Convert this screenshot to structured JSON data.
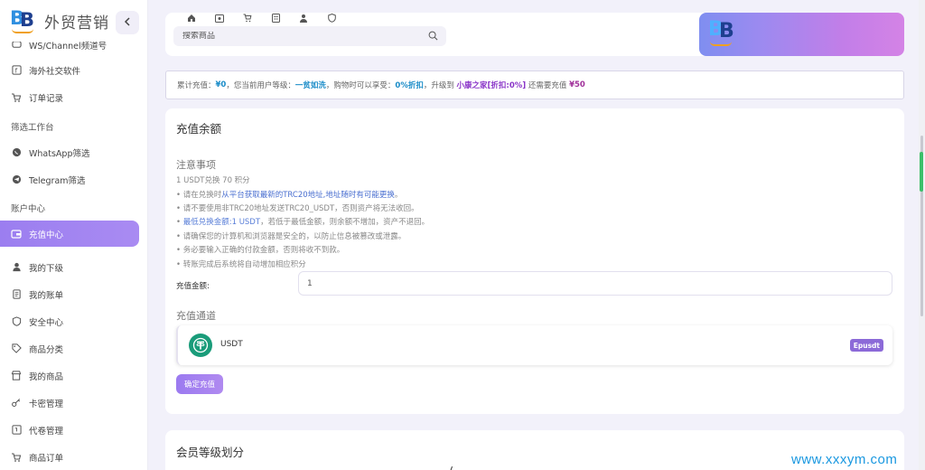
{
  "brand": {
    "name": "外贸营销",
    "logo_text_1": "B",
    "logo_text_2": "B",
    "collapse_icon": "chevron-left-icon"
  },
  "sidebar": {
    "items": [
      {
        "label": "WS/Channel频道号",
        "icon": "chat-icon"
      },
      {
        "label": "海外社交软件",
        "icon": "facebook-icon"
      },
      {
        "label": "订单记录",
        "icon": "cart-icon"
      },
      {
        "label": "WhatsApp筛选",
        "icon": "whatsapp-icon"
      },
      {
        "label": "Telegram筛选",
        "icon": "telegram-icon"
      },
      {
        "label": "充值中心",
        "icon": "wallet-icon"
      },
      {
        "label": "我的下级",
        "icon": "user-icon"
      },
      {
        "label": "我的账单",
        "icon": "bill-icon"
      },
      {
        "label": "安全中心",
        "icon": "shield-icon"
      },
      {
        "label": "商品分类",
        "icon": "tag-icon"
      },
      {
        "label": "我的商品",
        "icon": "store-icon"
      },
      {
        "label": "卡密管理",
        "icon": "key-icon"
      },
      {
        "label": "代卷管理",
        "icon": "ticket-icon"
      },
      {
        "label": "商品订单",
        "icon": "order-cart-icon"
      }
    ],
    "sections": {
      "filter": "筛选工作台",
      "account": "账户中心"
    },
    "active": "充值中心"
  },
  "header": {
    "nav_icons": [
      "home-icon",
      "image-icon",
      "cart-icon",
      "document-icon",
      "user-icon",
      "shield-icon"
    ],
    "search_placeholder": "搜索商品"
  },
  "infobar": {
    "p1": "累计充值：",
    "total": "¥0",
    "p2": "，您当前用户等级：",
    "level": "一贫如洗",
    "p3": "，购物时可以享受：",
    "discount": "0%折扣",
    "p4": "，升级到 ",
    "next_level": "小康之家[折扣:0%]",
    "p5": " 还需要充值 ",
    "need": "¥50"
  },
  "recharge": {
    "title": "充值余额",
    "notes_title": "注意事项",
    "rate": "1 USDT兑换 70 积分",
    "notes": [
      {
        "prefix": "• 请在兑换时",
        "highlight": "从平台获取最新的TRC20地址,地址随时有可能更换",
        "suffix": "。"
      },
      {
        "prefix": "• 请不要使用非TRC20地址发送TRC20_USDT，否则资产将无法收回。",
        "highlight": "",
        "suffix": ""
      },
      {
        "prefix": "• ",
        "highlight": "最低兑换金额:1 USDT",
        "suffix": "，若低于最低金额，则余额不增加，资产不退回。"
      },
      {
        "prefix": "• 请确保您的计算机和浏览器是安全的，以防止信息被篡改或泄露。",
        "highlight": "",
        "suffix": ""
      },
      {
        "prefix": "• 务必要输入正确的付款金额，否则将收不到款。",
        "highlight": "",
        "suffix": ""
      },
      {
        "prefix": "• 转账完成后系统将自动增加相应积分",
        "highlight": "",
        "suffix": ""
      }
    ],
    "amount_label": "充值金额:",
    "amount_value": "1",
    "channel_title": "充值通道",
    "channel": {
      "name": "USDT",
      "badge": "Epusdt",
      "icon": "tether-icon",
      "color": "#1a9c7a"
    },
    "confirm_label": "确定充值"
  },
  "level_card": {
    "title": "会员等级划分"
  },
  "watermark": "www.xxxym.com",
  "colors": {
    "accent": "#9b7ef0",
    "highlight_blue": "#1a8cc8",
    "highlight_purple": "#8a35c8"
  }
}
